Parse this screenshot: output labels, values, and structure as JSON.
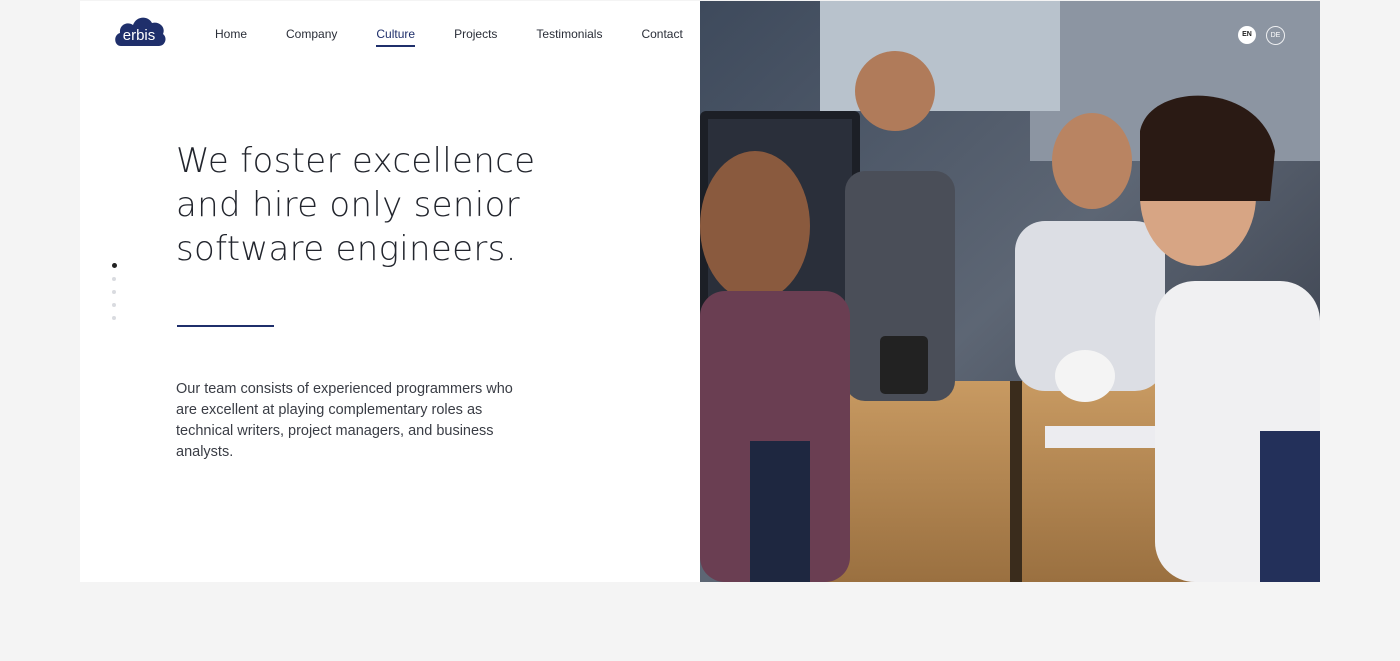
{
  "brand": {
    "logo_text": "erbis",
    "logo_color": "#1f2f6b"
  },
  "nav": {
    "items": [
      {
        "label": "Home",
        "active": false
      },
      {
        "label": "Company",
        "active": false
      },
      {
        "label": "Culture",
        "active": true
      },
      {
        "label": "Projects",
        "active": false
      },
      {
        "label": "Testimonials",
        "active": false
      },
      {
        "label": "Contact",
        "active": false
      }
    ]
  },
  "language": {
    "options": [
      "EN",
      "DE"
    ],
    "selected": "EN"
  },
  "slider": {
    "count": 5,
    "active_index": 0
  },
  "hero": {
    "headline": "We foster excellence and hire only senior software engineers.",
    "body": "Our team consists of experienced programmers who are excellent at playing complementary roles as technical writers, project managers, and business analysts."
  },
  "colors": {
    "accent": "#1f2f6b",
    "background": "#f4f4f4",
    "panel": "#ffffff"
  }
}
